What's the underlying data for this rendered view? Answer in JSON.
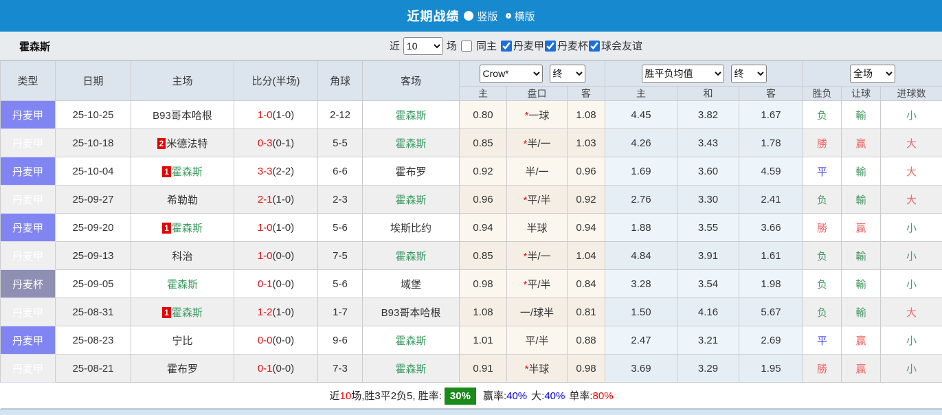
{
  "colors": {
    "topbar_blue": "#1689cf",
    "league_purple": "#8185f2",
    "cup_purple": "#8f8fb3",
    "team_green": "#3a9a62",
    "score_red": "#e81010",
    "win_red": "#ef6666",
    "lose_green": "#4a9a64",
    "draw_blue": "#3b3bdd",
    "rate_badge_green": "#1a8a1a"
  },
  "topbar": {
    "title": "近期战绩",
    "vertical_label": "竖版",
    "horizontal_label": "横版",
    "vertical_selected": true
  },
  "filter": {
    "team": "霍森斯",
    "recent_label": "近",
    "recent_value": "10",
    "matches_label": "场",
    "same_home_label": "同主",
    "same_home_checked": false,
    "leagues": [
      {
        "label": "丹麦甲",
        "checked": true
      },
      {
        "label": "丹麦杯",
        "checked": true
      },
      {
        "label": "球会友谊",
        "checked": true
      }
    ]
  },
  "table": {
    "col_headers": [
      "类型",
      "日期",
      "主场",
      "比分(半场)",
      "角球",
      "客场"
    ],
    "selects": {
      "company": "Crow*",
      "t1": "终",
      "avg": "胜平负均值",
      "t2": "终",
      "scope": "全场"
    },
    "sub_headers": [
      "主",
      "盘口",
      "客",
      "主",
      "和",
      "客",
      "胜负",
      "让球",
      "进球数"
    ],
    "rows": [
      {
        "league": "丹麦甲",
        "cup": false,
        "date": "25-10-25",
        "home": "B93哥本哈根",
        "home_green": false,
        "home_cards": "",
        "score_ft": "1-0",
        "score_ht": "(1-0)",
        "corners": "2-12",
        "away": "霍森斯",
        "away_green": true,
        "odds_home": "0.80",
        "star": true,
        "handicap": "一球",
        "odds_away": "1.08",
        "avg_home": "4.45",
        "avg_draw": "3.82",
        "avg_away": "1.67",
        "result": "负",
        "result_c": "g",
        "let_ball": "輸",
        "let_c": "g",
        "goals": "小",
        "goals_c": "g"
      },
      {
        "league": "丹麦甲",
        "cup": false,
        "date": "25-10-18",
        "home": "米德法特",
        "home_green": false,
        "home_cards": "2",
        "score_ft": "0-3",
        "score_ht": "(0-1)",
        "corners": "5-5",
        "away": "霍森斯",
        "away_green": true,
        "odds_home": "0.85",
        "star": true,
        "handicap": "半/一",
        "odds_away": "1.03",
        "avg_home": "4.26",
        "avg_draw": "3.43",
        "avg_away": "1.78",
        "result": "勝",
        "result_c": "r",
        "let_ball": "贏",
        "let_c": "r",
        "goals": "大",
        "goals_c": "r"
      },
      {
        "league": "丹麦甲",
        "cup": false,
        "date": "25-10-04",
        "home": "霍森斯",
        "home_green": true,
        "home_cards": "1",
        "score_ft": "3-3",
        "score_ht": "(2-2)",
        "corners": "6-6",
        "away": "霍布罗",
        "away_green": false,
        "odds_home": "0.92",
        "star": false,
        "handicap": "半/一",
        "odds_away": "0.96",
        "avg_home": "1.69",
        "avg_draw": "3.60",
        "avg_away": "4.59",
        "result": "平",
        "result_c": "b",
        "let_ball": "輸",
        "let_c": "g",
        "goals": "大",
        "goals_c": "r"
      },
      {
        "league": "丹麦甲",
        "cup": false,
        "date": "25-09-27",
        "home": "希勒勒",
        "home_green": false,
        "home_cards": "",
        "score_ft": "2-1",
        "score_ht": "(1-0)",
        "corners": "2-3",
        "away": "霍森斯",
        "away_green": true,
        "odds_home": "0.96",
        "star": true,
        "handicap": "平/半",
        "odds_away": "0.92",
        "avg_home": "2.76",
        "avg_draw": "3.30",
        "avg_away": "2.41",
        "result": "负",
        "result_c": "g",
        "let_ball": "輸",
        "let_c": "g",
        "goals": "大",
        "goals_c": "r"
      },
      {
        "league": "丹麦甲",
        "cup": false,
        "date": "25-09-20",
        "home": "霍森斯",
        "home_green": true,
        "home_cards": "1",
        "score_ft": "1-0",
        "score_ht": "(1-0)",
        "corners": "5-6",
        "away": "埃斯比约",
        "away_green": false,
        "odds_home": "0.94",
        "star": false,
        "handicap": "半球",
        "odds_away": "0.94",
        "avg_home": "1.88",
        "avg_draw": "3.55",
        "avg_away": "3.66",
        "result": "勝",
        "result_c": "r",
        "let_ball": "贏",
        "let_c": "r",
        "goals": "小",
        "goals_c": "g"
      },
      {
        "league": "丹麦甲",
        "cup": false,
        "date": "25-09-13",
        "home": "科治",
        "home_green": false,
        "home_cards": "",
        "score_ft": "1-0",
        "score_ht": "(0-0)",
        "corners": "7-5",
        "away": "霍森斯",
        "away_green": true,
        "odds_home": "0.85",
        "star": true,
        "handicap": "半/一",
        "odds_away": "1.04",
        "avg_home": "4.84",
        "avg_draw": "3.91",
        "avg_away": "1.61",
        "result": "负",
        "result_c": "g",
        "let_ball": "輸",
        "let_c": "g",
        "goals": "小",
        "goals_c": "g"
      },
      {
        "league": "丹麦杯",
        "cup": true,
        "date": "25-09-05",
        "home": "霍森斯",
        "home_green": true,
        "home_cards": "",
        "score_ft": "0-1",
        "score_ht": "(0-0)",
        "corners": "5-6",
        "away": "域堡",
        "away_green": false,
        "odds_home": "0.98",
        "star": true,
        "handicap": "平/半",
        "odds_away": "0.84",
        "avg_home": "3.28",
        "avg_draw": "3.54",
        "avg_away": "1.98",
        "result": "负",
        "result_c": "g",
        "let_ball": "輸",
        "let_c": "g",
        "goals": "小",
        "goals_c": "g"
      },
      {
        "league": "丹麦甲",
        "cup": false,
        "date": "25-08-31",
        "home": "霍森斯",
        "home_green": true,
        "home_cards": "1",
        "score_ft": "1-2",
        "score_ht": "(1-0)",
        "corners": "1-7",
        "away": "B93哥本哈根",
        "away_green": false,
        "odds_home": "1.08",
        "star": false,
        "handicap": "一/球半",
        "odds_away": "0.81",
        "avg_home": "1.50",
        "avg_draw": "4.16",
        "avg_away": "5.67",
        "result": "负",
        "result_c": "g",
        "let_ball": "輸",
        "let_c": "g",
        "goals": "大",
        "goals_c": "r"
      },
      {
        "league": "丹麦甲",
        "cup": false,
        "date": "25-08-23",
        "home": "宁比",
        "home_green": false,
        "home_cards": "",
        "score_ft": "0-0",
        "score_ht": "(0-0)",
        "corners": "9-6",
        "away": "霍森斯",
        "away_green": true,
        "odds_home": "1.01",
        "star": false,
        "handicap": "平/半",
        "odds_away": "0.88",
        "avg_home": "2.47",
        "avg_draw": "3.21",
        "avg_away": "2.69",
        "result": "平",
        "result_c": "b",
        "let_ball": "贏",
        "let_c": "r",
        "goals": "小",
        "goals_c": "g"
      },
      {
        "league": "丹麦甲",
        "cup": false,
        "date": "25-08-21",
        "home": "霍布罗",
        "home_green": false,
        "home_cards": "",
        "score_ft": "0-1",
        "score_ht": "(0-0)",
        "corners": "7-3",
        "away": "霍森斯",
        "away_green": true,
        "odds_home": "0.91",
        "star": true,
        "handicap": "半球",
        "odds_away": "0.98",
        "avg_home": "3.69",
        "avg_draw": "3.29",
        "avg_away": "1.95",
        "result": "勝",
        "result_c": "r",
        "let_ball": "贏",
        "let_c": "r",
        "goals": "小",
        "goals_c": "g"
      }
    ]
  },
  "summary": {
    "p1": "近",
    "p2": "10",
    "p3": "场,胜3平2负5, 胜率:",
    "rate": "30%",
    "p4": "赢率:",
    "p5": "40%",
    "p6": "大:",
    "p7": "40%",
    "p8": "单率:",
    "p9": "80%"
  }
}
